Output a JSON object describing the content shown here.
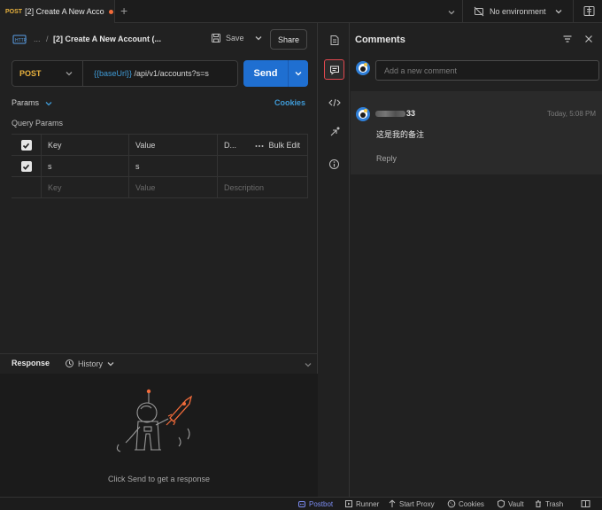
{
  "tab": {
    "method": "POST",
    "title": "[2] Create A New Acco",
    "new_tab_symbol": "+"
  },
  "environment": {
    "selected": "No environment"
  },
  "request": {
    "breadcrumb_ellipsis": "...",
    "breadcrumb_sep": "/",
    "title": "[2] Create A New Account (...",
    "save_label": "Save",
    "share_label": "Share",
    "method": "POST",
    "url_variable": "{{baseUrl}}",
    "url_path": " /api/v1/accounts?s=s",
    "send_label": "Send"
  },
  "params": {
    "tab_label": "Params",
    "cookies_label": "Cookies",
    "section_title": "Query Params",
    "columns": {
      "key": "Key",
      "value": "Value",
      "description": "D...",
      "bulk_edit": "Bulk Edit"
    },
    "rows": [
      {
        "key": "s",
        "value": "s",
        "description": ""
      }
    ],
    "placeholder": {
      "key": "Key",
      "value": "Value",
      "description": "Description"
    }
  },
  "response": {
    "title": "Response",
    "history_label": "History",
    "empty_message": "Click Send to get a response"
  },
  "comments": {
    "title": "Comments",
    "input_placeholder": "Add a new comment",
    "items": [
      {
        "user_suffix": "33",
        "time": "Today, 5:08 PM",
        "text": "这是我的备注",
        "reply_label": "Reply"
      }
    ]
  },
  "status_bar": {
    "postbot": "Postbot",
    "runner": "Runner",
    "start_proxy": "Start Proxy",
    "cookies": "Cookies",
    "vault": "Vault",
    "trash": "Trash"
  },
  "colors": {
    "post_method": "#e9b23e",
    "send_button": "#1f6fd1",
    "link_blue": "#3f9bd7",
    "active_highlight": "#e2484f",
    "unsaved_dot": "#f26b3a",
    "postbot": "#7b8bf0"
  },
  "icons": [
    "http-request-icon",
    "save-icon",
    "chevron-down-icon",
    "document-icon",
    "comment-icon",
    "code-icon",
    "related-icon",
    "info-icon",
    "filter-icon",
    "close-icon",
    "avatar-icon",
    "history-icon",
    "more-icon",
    "astronaut-illustration"
  ]
}
